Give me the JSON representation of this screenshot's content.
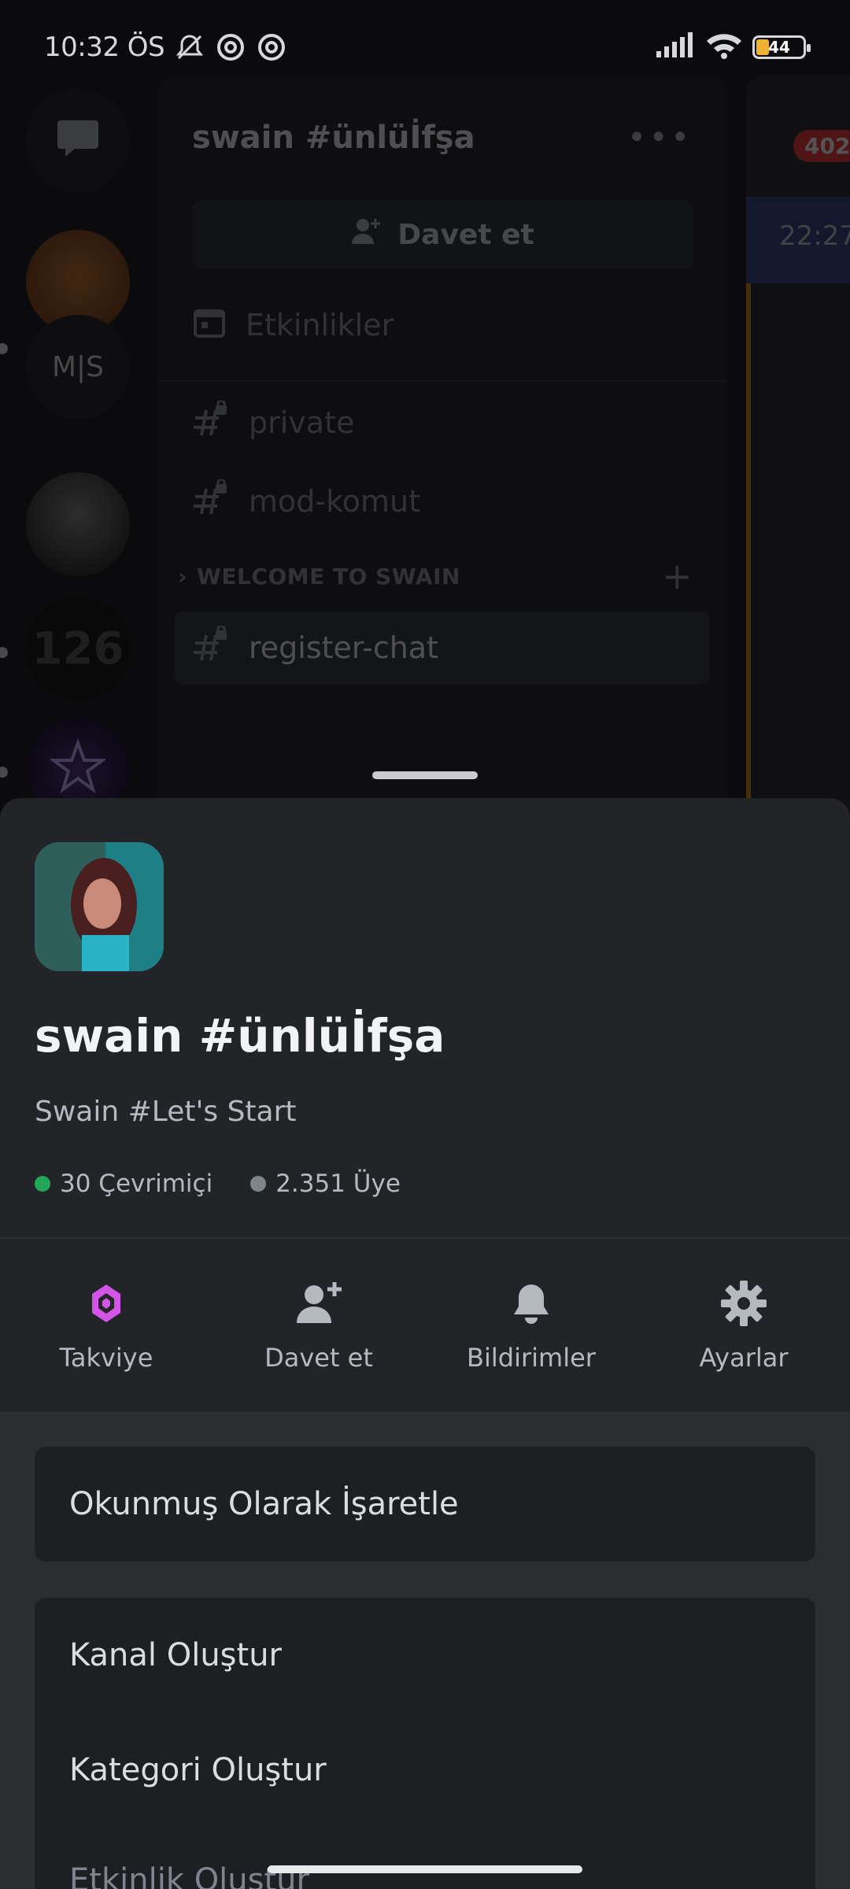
{
  "status_bar": {
    "time": "10:32 ÖS",
    "battery": "44"
  },
  "background": {
    "server_title": "swain #ünlüİfşa",
    "more": "•••",
    "invite_label": "Davet et",
    "events_label": "Etkinlikler",
    "channels": [
      {
        "name": "private"
      },
      {
        "name": "mod-komut"
      }
    ],
    "category": "WELCOME TO SWAIN",
    "active_channel": "register-chat",
    "rail": {
      "ms_label": "M|S",
      "num_label": "126"
    },
    "right_strip": {
      "badge": "402",
      "time": "22:27"
    }
  },
  "sheet": {
    "server_name": "swain #ünlüİfşa",
    "description": "Swain #Let's Start",
    "online": "30 Çevrimiçi",
    "members": "2.351 Üye",
    "colors": {
      "online_dot": "#23a55a",
      "members_dot": "#80848e",
      "boost": "#d355e6"
    },
    "actions": [
      {
        "label": "Takviye",
        "icon": "boost-icon"
      },
      {
        "label": "Davet et",
        "icon": "add-user-icon"
      },
      {
        "label": "Bildirimler",
        "icon": "bell-icon"
      },
      {
        "label": "Ayarlar",
        "icon": "gear-icon"
      }
    ],
    "menu": {
      "mark_read": "Okunmuş Olarak İşaretle",
      "create_channel": "Kanal Oluştur",
      "create_category": "Kategori Oluştur",
      "create_event": "Etkinlik Oluştur"
    }
  }
}
